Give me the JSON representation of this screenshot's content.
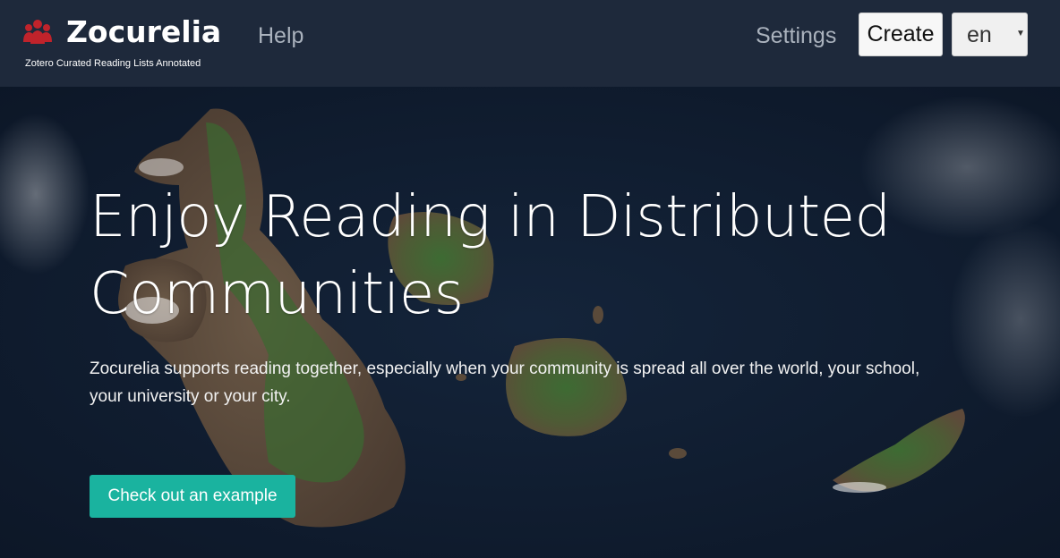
{
  "header": {
    "brand_name": "Zocurelia",
    "brand_subtitle": "Zotero Curated Reading Lists Annotated",
    "brand_icon": "users-icon",
    "brand_icon_color": "#c0232b",
    "nav": {
      "help": "Help",
      "settings": "Settings"
    },
    "create_label": "Create",
    "language": {
      "selected": "en",
      "caret_icon": "caret-down-icon"
    }
  },
  "hero": {
    "title": "Enjoy Reading in Distributed Communities",
    "description": "Zocurelia supports reading together, especially when your community is spread all over the world, your school, your university or your city.",
    "cta_label": "Check out an example",
    "cta_color": "#1ab39f",
    "background": "satellite-islands-image"
  },
  "colors": {
    "navbar_bg": "#1e293b",
    "nav_link": "#aab2bd",
    "ocean": "#0f1b2b"
  }
}
